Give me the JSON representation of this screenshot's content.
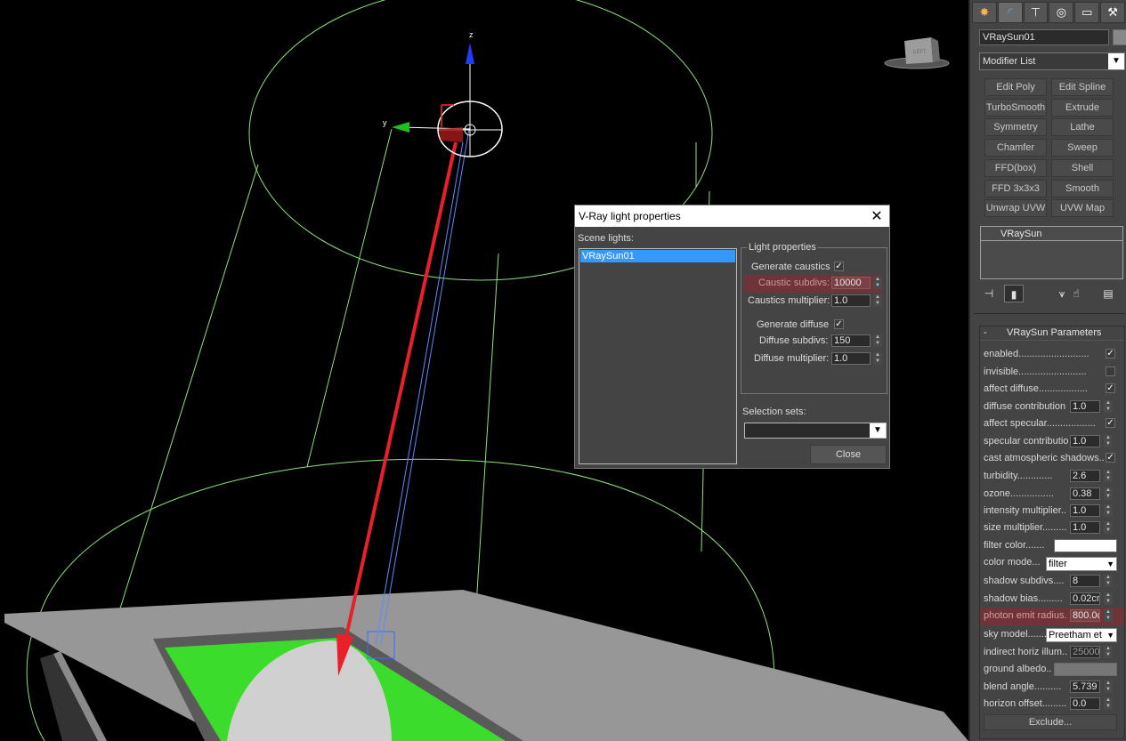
{
  "viewport": {
    "axis_z": "z",
    "axis_y": "y",
    "viewcube_label": "LEFT"
  },
  "dialog": {
    "title": "V-Ray light properties",
    "scene_lights_label": "Scene lights:",
    "scene_lights": [
      "VRaySun01"
    ],
    "light_properties_label": "Light properties",
    "generate_caustics_label": "Generate caustics",
    "generate_caustics_checked": "✓",
    "caustic_subdivs_label": "Caustic subdivs:",
    "caustic_subdivs_value": "10000",
    "caustics_multiplier_label": "Caustics multiplier:",
    "caustics_multiplier_value": "1.0",
    "generate_diffuse_label": "Generate diffuse",
    "generate_diffuse_checked": "✓",
    "diffuse_subdivs_label": "Diffuse subdivs:",
    "diffuse_subdivs_value": "150",
    "diffuse_multiplier_label": "Diffuse multiplier:",
    "diffuse_multiplier_value": "1.0",
    "selection_sets_label": "Selection sets:",
    "close_label": "Close"
  },
  "panel": {
    "object_name": "VRaySun01",
    "modifier_list": "Modifier List",
    "modifier_buttons": [
      "Edit Poly",
      "Edit Spline",
      "TurboSmooth",
      "Extrude",
      "Symmetry",
      "Lathe",
      "Chamfer",
      "Sweep",
      "FFD(box)",
      "Shell",
      "FFD 3x3x3",
      "Smooth",
      "Unwrap UVW",
      "UVW Map"
    ],
    "stack_entry": "VRaySun",
    "rollout_minus": "-",
    "rollout_title": "VRaySun Parameters",
    "params": {
      "enabled": "enabled..........................",
      "invisible": "invisible.........................",
      "affect_diffuse": "affect diffuse..................",
      "diffuse_contribution": "diffuse contribution",
      "diffuse_contribution_value": "1.0",
      "affect_specular": "affect specular..................",
      "specular_contribution": "specular contributio",
      "specular_contribution_value": "1.0",
      "cast_atmospheric_shadows": "cast atmospheric shadows..",
      "turbidity": "turbidity.............",
      "turbidity_value": "2.6",
      "ozone": "ozone................",
      "ozone_value": "0.38",
      "intensity_multiplier": "intensity multiplier..",
      "intensity_multiplier_value": "1.0",
      "size_multiplier": "size multiplier.........",
      "size_multiplier_value": "1.0",
      "filter_color": "filter color.......",
      "color_mode": "color mode...",
      "color_mode_value": "filter",
      "shadow_subdivs": "shadow subdivs....",
      "shadow_subdivs_value": "8",
      "shadow_bias": "shadow bias.........",
      "shadow_bias_value": "0.02cm",
      "photon_emit_radius": "photon emit radius.",
      "photon_emit_radius_value": "800.0c",
      "sky_model": "sky model........",
      "sky_model_value": "Preetham et",
      "indirect_horiz_illum": "indirect horiz illum..",
      "indirect_horiz_illum_value": "25000.",
      "ground_albedo": "ground albedo..",
      "blend_angle": "blend angle..........",
      "blend_angle_value": "5.739",
      "horizon_offset": "horizon offset.........",
      "horizon_offset_value": "0.0",
      "check_mark": "✓",
      "exclude": "Exclude..."
    }
  },
  "colors": {
    "wire_green": "#8be37a",
    "arrow_red": "#e8202a",
    "highlight_red": "#6e3438",
    "selection_blue": "#3399ff",
    "panel_gray": "#444444"
  }
}
